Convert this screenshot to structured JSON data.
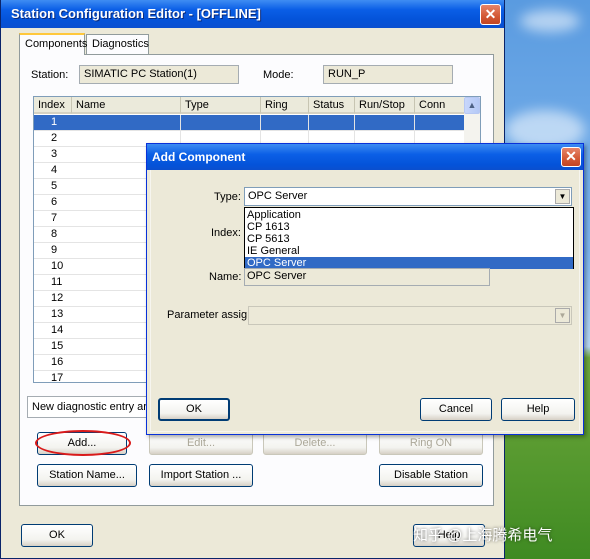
{
  "main_window": {
    "title": "Station Configuration Editor - [OFFLINE]",
    "close_glyph": "✕",
    "tabs": [
      {
        "label": "Components",
        "active": true
      },
      {
        "label": "Diagnostics",
        "active": false
      }
    ],
    "station_label": "Station:",
    "station_value": "SIMATIC PC Station(1)",
    "mode_label": "Mode:",
    "mode_value": "RUN_P",
    "table": {
      "columns": [
        "Index",
        "Name",
        "Type",
        "Ring",
        "Status",
        "Run/Stop",
        "Conn"
      ],
      "rows": [
        "1",
        "2",
        "3",
        "4",
        "5",
        "6",
        "7",
        "8",
        "9",
        "10",
        "11",
        "12",
        "13",
        "14",
        "15",
        "16",
        "17"
      ],
      "selected_row": "1"
    },
    "status_text": "New diagnostic entry arrived",
    "buttons": {
      "add": "Add...",
      "edit": "Edit...",
      "delete": "Delete...",
      "ring_on": "Ring ON",
      "station_name": "Station Name...",
      "import_station": "Import Station ...",
      "disable_station": "Disable Station",
      "ok": "OK",
      "help": "Help"
    },
    "accent_colors": {
      "selection": "#316ac5",
      "annotation_circle": "#d91a1a"
    }
  },
  "add_component_dialog": {
    "title": "Add Component",
    "close_glyph": "✕",
    "type_label": "Type:",
    "type_value": "OPC Server",
    "type_options": [
      "Application",
      "CP 1613",
      "CP 5613",
      "IE General",
      "OPC Server"
    ],
    "type_selected_option": "OPC Server",
    "index_label": "Index:",
    "name_label": "Name:",
    "name_value": "OPC Server",
    "param_label": "Parameter assig.:",
    "param_value": "",
    "ok_button": "OK",
    "cancel_button": "Cancel",
    "help_button": "Help"
  },
  "watermark": "知乎 @上海腾希电气"
}
